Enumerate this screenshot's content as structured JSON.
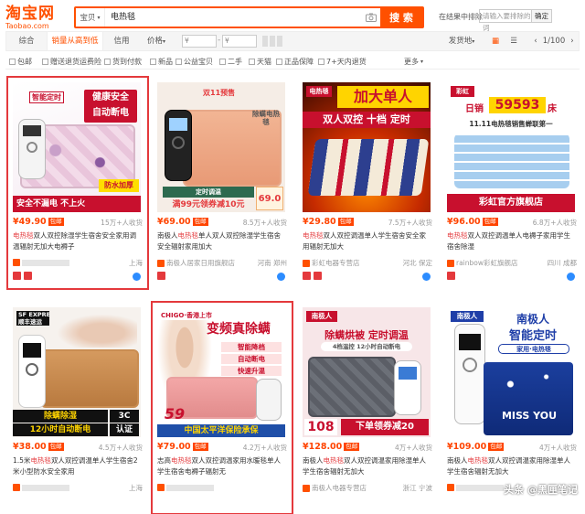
{
  "header": {
    "logo_cn": "淘宝网",
    "logo_en": "Taobao.com",
    "search_scope": "宝贝",
    "search_query": "电热毯",
    "search_button": "搜 索",
    "in_results_label": "在结果中排除",
    "in_results_placeholder": "请输入要排除的词",
    "in_results_button": "确定"
  },
  "sortbar": {
    "items": [
      "综合",
      "销量从高到低",
      "信用",
      "价格"
    ],
    "price_from": "¥",
    "price_to": "¥",
    "ship_from": "发货地",
    "page": "1/100"
  },
  "filters": [
    "包邮",
    "赠送退货运费险",
    "货到付款",
    "新品",
    "公益宝贝",
    "二手",
    "天猫",
    "正品保障",
    "7+天内退货"
  ],
  "filters_more": "更多",
  "products": [
    {
      "price": "¥49.90",
      "pay": "15万+人收货",
      "title_pre": "",
      "title_hl": "电热毯",
      "title_post": "双人双控除湿学生宿舍安全家用调温辐射无加大电褥子",
      "shop": "",
      "loc": "上海",
      "img_text": [
        "健康安全",
        "自动断电",
        "智能定时",
        "安全不漏电",
        "不上火",
        "防水加厚"
      ]
    },
    {
      "price": "¥69.00",
      "pay": "8.5万+人收货",
      "title_pre": "南极人",
      "title_hl": "电热毯",
      "title_post": "单人双人双控除湿学生宿舍安全辐射家用加大",
      "shop": "南极人居家日用旗舰店",
      "loc": "河南 郑州",
      "img_text": [
        "双11预售",
        "除螨电热毯",
        "定时调温",
        "满99元领券减10元",
        "69.0"
      ]
    },
    {
      "price": "¥29.80",
      "pay": "7.5万+人收货",
      "title_pre": "",
      "title_hl": "电热毯",
      "title_post": "双人双控调温单人学生宿舍安全家用辐射无加大",
      "shop": "彩虹电器专营店",
      "loc": "河北 保定",
      "img_text": [
        "电热毯",
        "加大单人",
        "双人双控 十档 定时"
      ]
    },
    {
      "price": "¥96.00",
      "pay": "6.8万+人收货",
      "title_pre": "",
      "title_hl": "电热毯",
      "title_post": "双人双控调温单人电褥子家用学生宿舍除湿",
      "shop": "rainbow彩虹旗舰店",
      "loc": "四川 成都",
      "img_text": [
        "彩虹",
        "日销",
        "59593",
        "床",
        "11.11电热毯销售蝉联第一",
        "彩虹官方旗舰店"
      ]
    },
    {
      "price": "¥38.00",
      "pay": "4.5万+人收货",
      "title_pre": "1.5米",
      "title_hl": "电热毯",
      "title_post": "双人双控调温单人学生宿舍2米小型防水安全家用",
      "shop": "",
      "loc": "上海",
      "img_text": [
        "SF EXPRESS",
        "顺丰速运",
        "除螨除湿",
        "3C",
        "12小时自动断电",
        "认证"
      ]
    },
    {
      "price": "¥79.00",
      "pay": "4.2万+人收货",
      "title_pre": "志高",
      "title_hl": "电热毯",
      "title_post": "双人双控调温家用水暖毯单人学生宿舍电褥子辐射无",
      "shop": "",
      "loc": "",
      "img_text": [
        "CHIGO·香港上市",
        "变频真除螨",
        "智能降档",
        "自动断电",
        "快速升温",
        "59",
        "中国太平洋保险承保"
      ]
    },
    {
      "price": "¥128.00",
      "pay": "4万+人收货",
      "title_pre": "南极人",
      "title_hl": "电热毯",
      "title_post": "双人双控调温家用除湿单人学生宿舍辐射无加大",
      "shop": "南极人电器专营店",
      "loc": "浙江 宁波",
      "img_text": [
        "南极人",
        "除螨烘被 定时调温",
        "4档温控 12小时自动断电",
        "108",
        "下单领券减20"
      ]
    },
    {
      "price": "¥109.00",
      "pay": "4万+人收货",
      "title_pre": "南极人",
      "title_hl": "电热毯",
      "title_post": "双人双控调温家用除湿单人学生宿舍辐射无加大",
      "shop": "",
      "loc": "",
      "img_text": [
        "南极人",
        "智能定时",
        "家用·电热毯",
        "MISS YOU"
      ]
    }
  ],
  "watermark": "头条 @黑匣笔记"
}
